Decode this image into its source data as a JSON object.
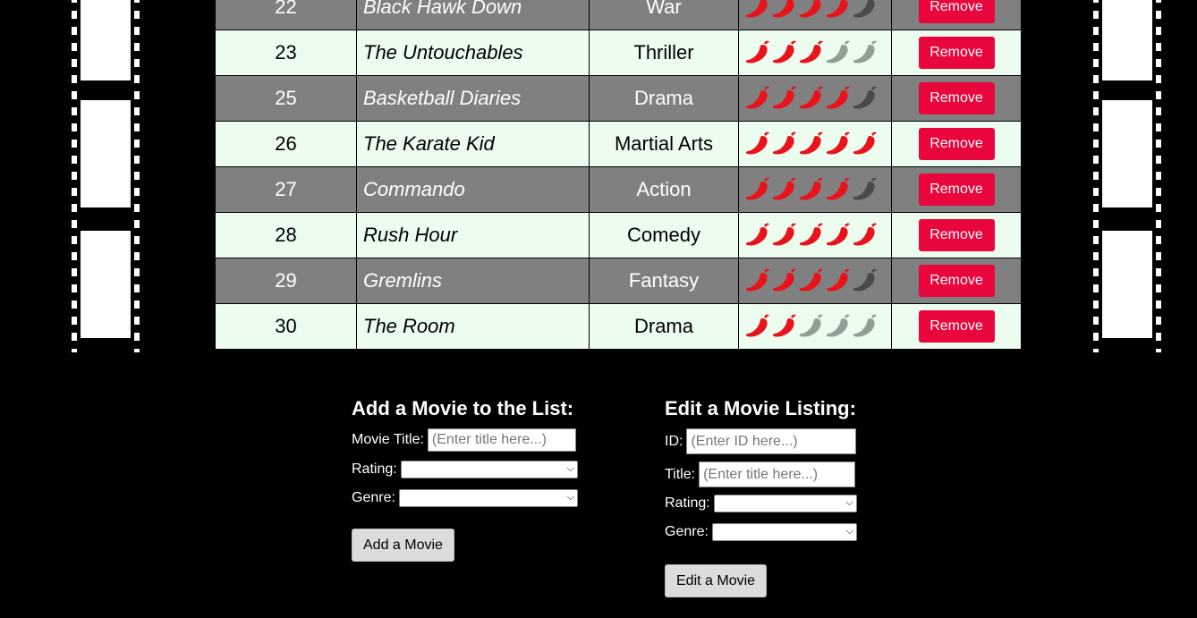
{
  "movies": [
    {
      "id": "22",
      "title": "Black Hawk Down",
      "genre": "War",
      "rating": 4
    },
    {
      "id": "23",
      "title": "The Untouchables",
      "genre": "Thriller",
      "rating": 3
    },
    {
      "id": "25",
      "title": "Basketball Diaries",
      "genre": "Drama",
      "rating": 4
    },
    {
      "id": "26",
      "title": "The Karate Kid",
      "genre": "Martial Arts",
      "rating": 5
    },
    {
      "id": "27",
      "title": "Commando",
      "genre": "Action",
      "rating": 4
    },
    {
      "id": "28",
      "title": "Rush Hour",
      "genre": "Comedy",
      "rating": 5
    },
    {
      "id": "29",
      "title": "Gremlins",
      "genre": "Fantasy",
      "rating": 4
    },
    {
      "id": "30",
      "title": "The Room",
      "genre": "Drama",
      "rating": 2
    }
  ],
  "rating_max": 5,
  "rating_icon": "chili-pepper-icon",
  "remove_label": "Remove",
  "colors": {
    "pepper_on": "#e8131b",
    "pepper_off_dark_row": "#4a4a4a",
    "pepper_off_light_row": "#8f9f93",
    "remove_button": "#e8063c",
    "row_odd": "#808080",
    "row_even": "#ecfcef",
    "background": "#000000"
  },
  "add_form": {
    "heading": "Add a Movie to the List:",
    "title_label": "Movie Title:",
    "title_placeholder": "(Enter title here...)",
    "rating_label": "Rating:",
    "genre_label": "Genre:",
    "submit_label": "Add a Movie"
  },
  "edit_form": {
    "heading": "Edit a Movie Listing:",
    "id_label": "ID:",
    "id_placeholder": "(Enter ID here...)",
    "title_label": "Title:",
    "title_placeholder": "(Enter title here...)",
    "rating_label": "Rating:",
    "genre_label": "Genre:",
    "submit_label": "Edit a Movie"
  }
}
